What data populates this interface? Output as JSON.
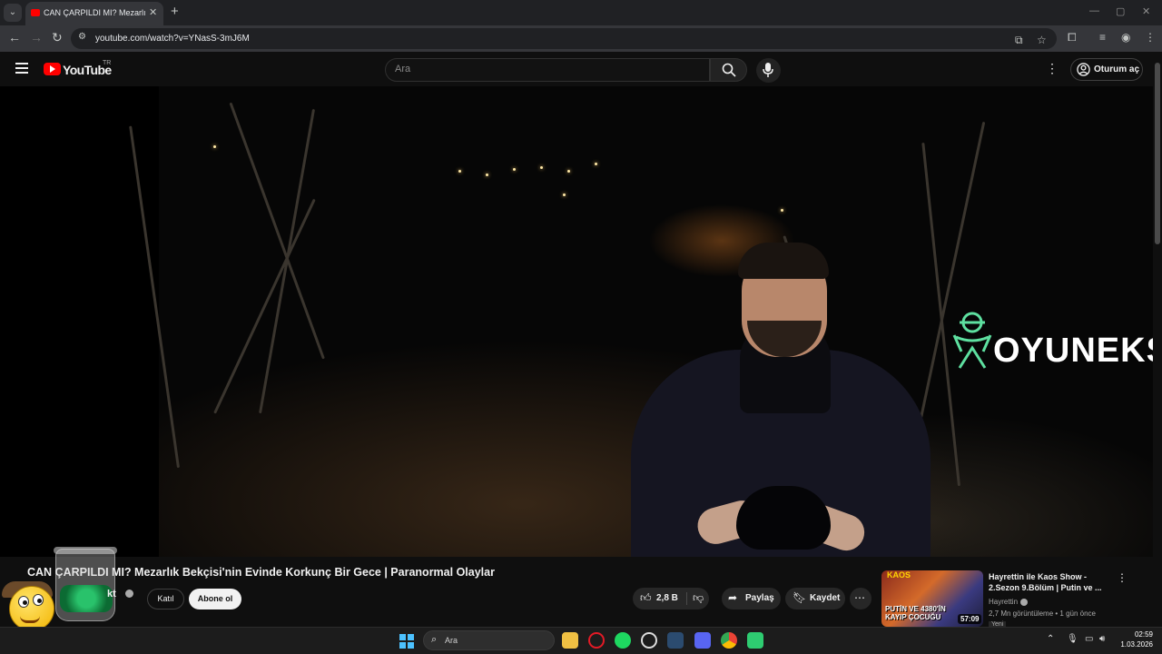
{
  "browser": {
    "tab_title": "CAN ÇARPILDI MI? Mezarlık Bekç",
    "tab_close": "✕",
    "new_tab": "+",
    "url": "youtube.com/watch?v=YNasS-3mJ6M",
    "window_controls": [
      "—",
      "▢",
      "✕"
    ]
  },
  "youtube": {
    "logo_text": "YouTube",
    "country_code": "TR",
    "search_placeholder": "Ara",
    "signin_label": "Oturum aç"
  },
  "player": {
    "watermark": "OYUNEKS"
  },
  "video": {
    "title": "CAN ÇARPILDI MI? Mezarlık Bekçisi'nin Evinde Korkunç Bir Gece | Paranormal Olaylar",
    "channel_name_visible": "kt",
    "join_label": "Katıl",
    "subscribe_label": "Abone ol",
    "like_count": "2,8 B",
    "share_label": "Paylaş",
    "save_label": "Kaydet"
  },
  "recommended": {
    "title": "Hayrettin ile Kaos Show - 2.Sezon 9.Bölüm | Putin ve ...",
    "channel": "Hayrettin",
    "meta": "2,7 Mn görüntüleme • 1 gün önce",
    "duration": "57:09",
    "thumb_caption": "PUTİN VE 4380'İN KAYIP ÇOCUĞU",
    "thumb_badge": "KAOS",
    "new_badge": "Yeni"
  },
  "taskbar": {
    "search_label": "Ara",
    "time": "02:59",
    "date": "1.03.2026"
  },
  "icons": {
    "windows-accent": "#4cc2ff",
    "youtube-red": "#ff0000",
    "watermark-green": "#5ee0a0"
  }
}
